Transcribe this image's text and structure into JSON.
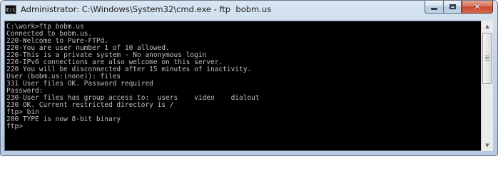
{
  "window": {
    "title": "Administrator: C:\\Windows\\System32\\cmd.exe - ftp  bobm.us",
    "app_icon": "cmd-icon",
    "app_icon_text": "C:\\",
    "caption_buttons": {
      "minimize_icon": "minimize-icon",
      "maximize_icon": "maximize-icon",
      "close_icon": "close-icon",
      "close_glyph": "✕"
    }
  },
  "console": {
    "background": "#000000",
    "foreground": "#c0c0c0",
    "lines": [
      "C:\\work>ftp bobm.us",
      "Connected to bobm.us.",
      "220-Welcome to Pure-FTPd.",
      "220-You are user number 1 of 10 allowed.",
      "220-This is a private system - No anonymous login",
      "220-IPv6 connections are also welcome on this server.",
      "220 You will be disconnected after 15 minutes of inactivity.",
      "User (bobm.us:(none)): files",
      "331 User files OK. Password required",
      "Password:",
      "230-User files has group access to:  users    video    dialout",
      "230 OK. Current restricted directory is /",
      "ftp> bin",
      "200 TYPE is now 8-bit binary",
      "ftp>"
    ]
  },
  "scrollbar": {
    "up_arrow": "▲",
    "down_arrow": "▼",
    "up_icon": "scroll-up-arrow-icon",
    "down_icon": "scroll-down-arrow-icon"
  }
}
